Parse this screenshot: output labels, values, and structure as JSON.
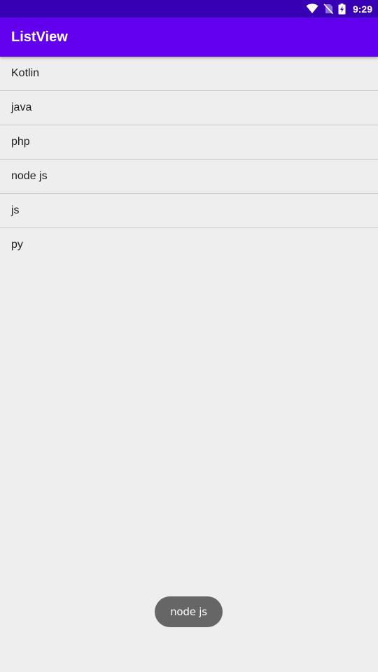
{
  "status_bar": {
    "time": "9:29",
    "icons": [
      "wifi-icon",
      "no-sim-icon",
      "battery-charging-icon"
    ],
    "background": "#3700b3"
  },
  "app_bar": {
    "title": "ListView",
    "background": "#6200ee"
  },
  "list": {
    "items": [
      {
        "label": "Kotlin"
      },
      {
        "label": "java"
      },
      {
        "label": "php"
      },
      {
        "label": "node js"
      },
      {
        "label": "js"
      },
      {
        "label": "py"
      }
    ]
  },
  "toast": {
    "message": "node js",
    "background": "#666666"
  },
  "colors": {
    "page_background": "#eeeeee",
    "divider": "#c9c9c9",
    "text": "#1f1f1f"
  }
}
